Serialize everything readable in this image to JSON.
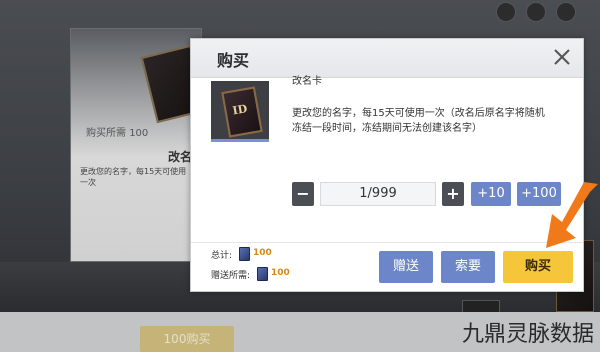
{
  "background": {
    "price_label": "购买所需",
    "price_value": "100",
    "card_title": "改名",
    "card_desc": "更改您的名字，每15天可使用一次",
    "bottom_button": "100购买"
  },
  "dialog": {
    "title": "购买",
    "item": {
      "name": "改名卡",
      "description": "更改您的名字，每15天可使用一次（改名后原名字将随机冻结一段时间，冻结期间无法创建该名字）",
      "thumb_text": "ID"
    },
    "quantity": {
      "minus": "−",
      "value": "1/999",
      "plus": "+",
      "add10": "+10",
      "add100": "+100"
    },
    "footer": {
      "total_label": "总计:",
      "total_value": "100",
      "gift_label": "赠送所需:",
      "gift_value": "100",
      "gift_button": "赠送",
      "request_button": "索要",
      "buy_button": "购买"
    }
  },
  "colors": {
    "accent_blue": "#6c86c9",
    "buy_yellow": "#f5c53a",
    "arrow_orange": "#f07a1a",
    "price_orange": "#d48a1a"
  },
  "watermark": "九鼎灵脉数据"
}
